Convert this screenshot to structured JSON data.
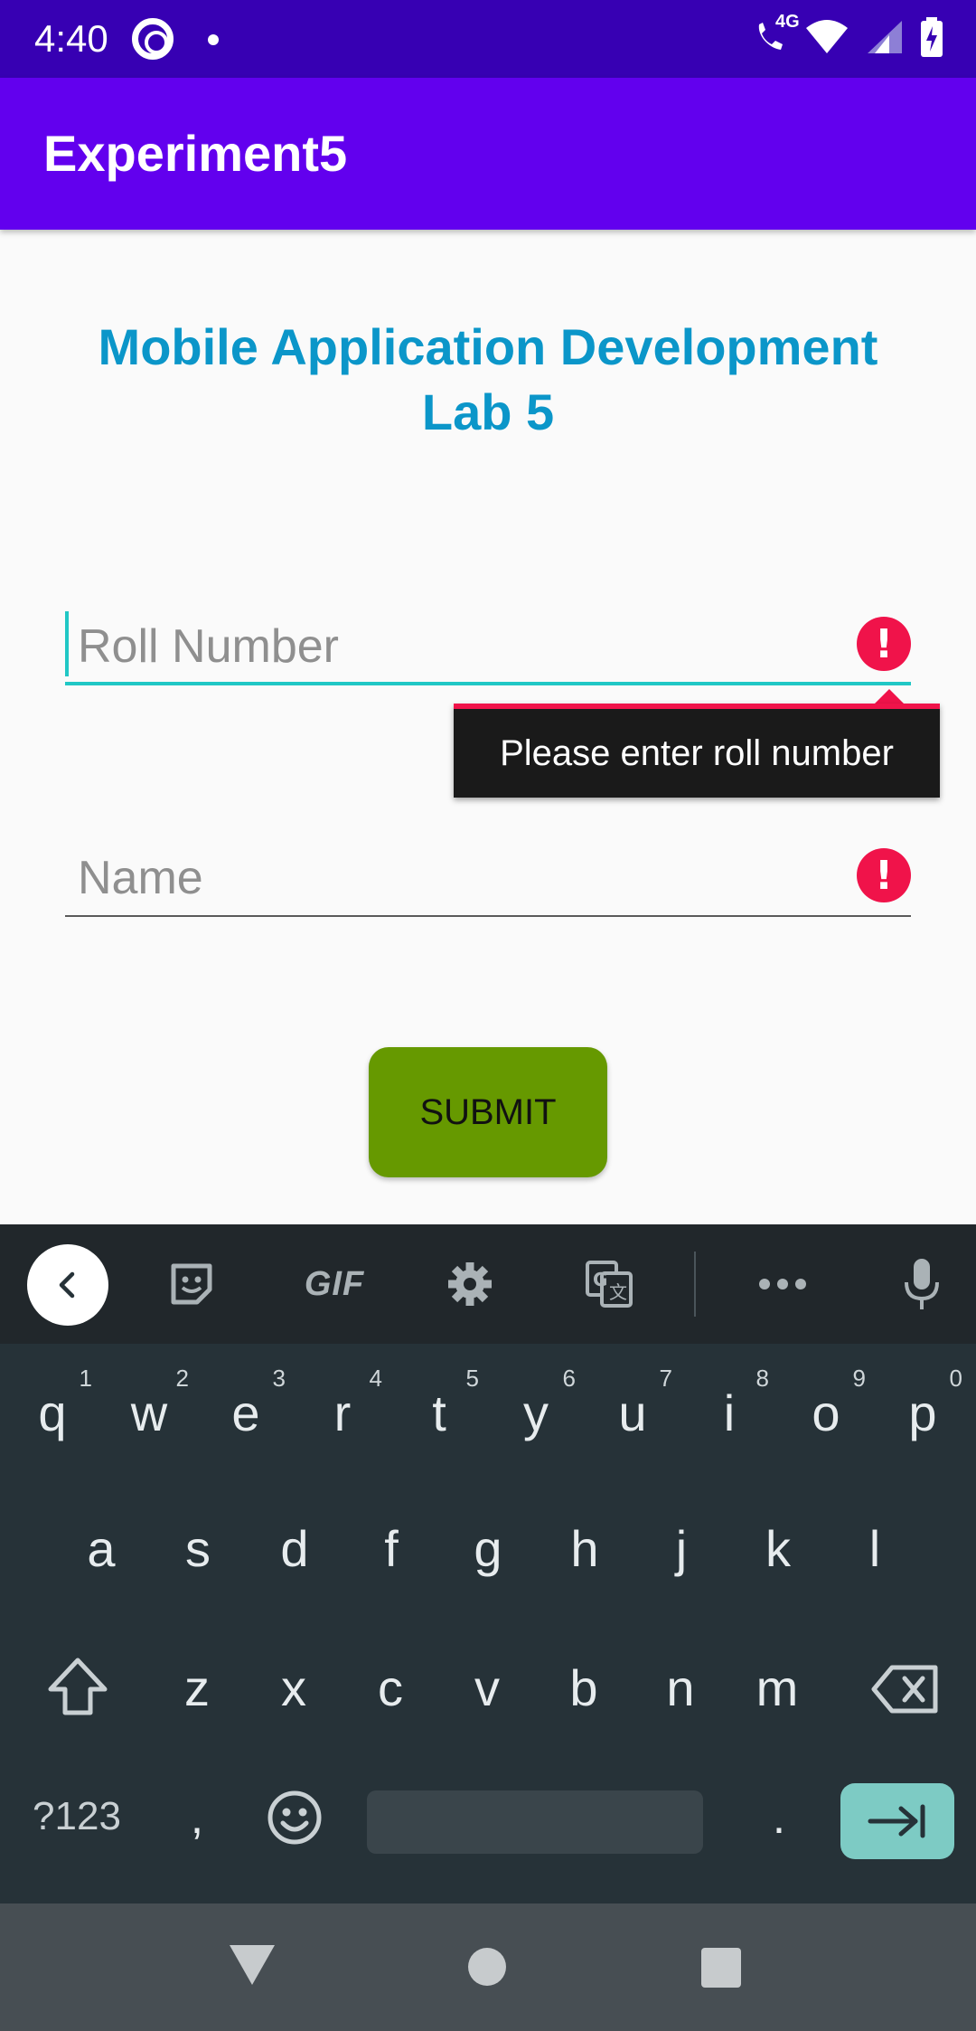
{
  "status_bar": {
    "time": "4:40",
    "network_label": "4G"
  },
  "app_bar": {
    "title": "Experiment5"
  },
  "main": {
    "heading_line1": "Mobile Application Development",
    "heading_line2": "Lab 5",
    "roll_field": {
      "placeholder": "Roll Number",
      "value": "",
      "error_visible": true,
      "error_message": "Please enter roll number"
    },
    "name_field": {
      "placeholder": "Name",
      "value": "",
      "error_visible": true
    },
    "submit_label": "SUBMIT"
  },
  "keyboard": {
    "toolbar": [
      "back",
      "sticker",
      "GIF",
      "settings",
      "translate",
      "more",
      "microphone"
    ],
    "gif_label": "GIF",
    "row1": [
      {
        "key": "q",
        "hint": "1"
      },
      {
        "key": "w",
        "hint": "2"
      },
      {
        "key": "e",
        "hint": "3"
      },
      {
        "key": "r",
        "hint": "4"
      },
      {
        "key": "t",
        "hint": "5"
      },
      {
        "key": "y",
        "hint": "6"
      },
      {
        "key": "u",
        "hint": "7"
      },
      {
        "key": "i",
        "hint": "8"
      },
      {
        "key": "o",
        "hint": "9"
      },
      {
        "key": "p",
        "hint": "0"
      }
    ],
    "row2": [
      "a",
      "s",
      "d",
      "f",
      "g",
      "h",
      "j",
      "k",
      "l"
    ],
    "row3": [
      "z",
      "x",
      "c",
      "v",
      "b",
      "n",
      "m"
    ],
    "symbols_label": "?123",
    "comma_label": ",",
    "period_label": "."
  },
  "colors": {
    "status_bar": "#3700b3",
    "app_bar": "#6200ee",
    "heading": "#0b96c9",
    "accent": "#20c7c5",
    "error": "#f0134a",
    "submit": "#669900"
  }
}
